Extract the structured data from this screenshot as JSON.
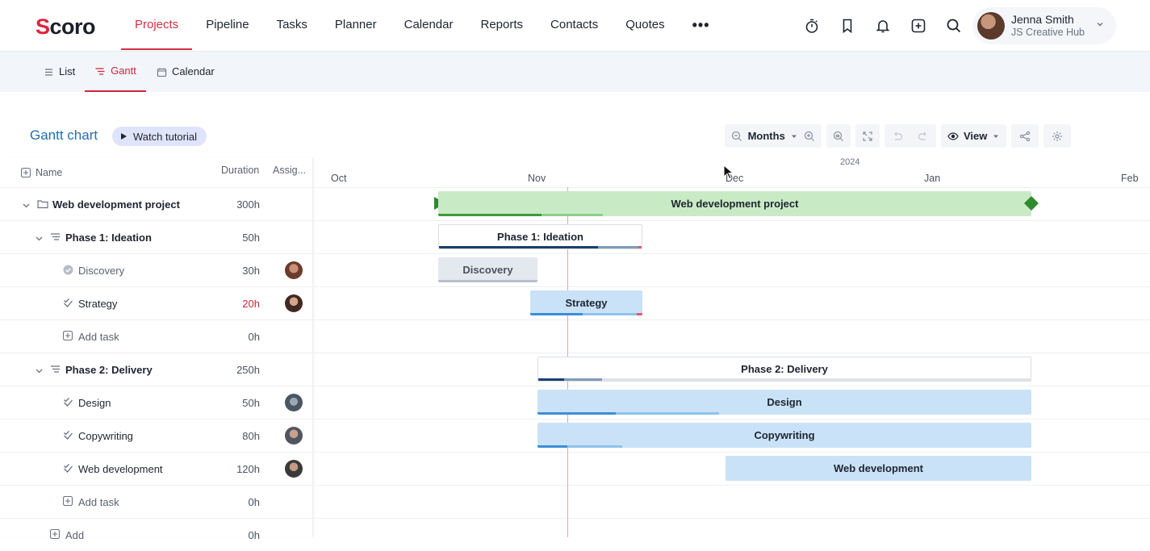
{
  "app": {
    "logo_text": "Scoro"
  },
  "nav": {
    "items": [
      "Projects",
      "Pipeline",
      "Tasks",
      "Planner",
      "Calendar",
      "Reports",
      "Contacts",
      "Quotes"
    ],
    "more": "•••",
    "active": "Projects"
  },
  "top_icons": [
    "stopwatch-icon",
    "bookmark-icon",
    "bell-icon",
    "plus-square-icon",
    "search-icon"
  ],
  "user": {
    "name": "Jenna Smith",
    "company": "JS Creative Hub"
  },
  "subtabs": [
    {
      "label": "List",
      "icon": "list-icon"
    },
    {
      "label": "Gantt",
      "icon": "gantt-icon",
      "active": true
    },
    {
      "label": "Calendar",
      "icon": "calendar-icon"
    }
  ],
  "gantt": {
    "title": "Gantt chart",
    "tutorial": "Watch tutorial"
  },
  "toolbar": {
    "scale": "Months",
    "view": "View"
  },
  "columns": {
    "name": "Name",
    "duration": "Duration",
    "assignee": "Assig..."
  },
  "timeline": {
    "year": "2024",
    "months": [
      "Oct",
      "Nov",
      "Dec",
      "Jan",
      "Feb"
    ]
  },
  "rows": [
    {
      "name": "Web development project",
      "duration": "300h",
      "type": "project"
    },
    {
      "name": "Phase 1: Ideation",
      "duration": "50h",
      "type": "phase"
    },
    {
      "name": "Discovery",
      "duration": "30h",
      "type": "task-done"
    },
    {
      "name": "Strategy",
      "duration": "20h",
      "type": "task",
      "over": true
    },
    {
      "name": "Add task",
      "duration": "0h",
      "type": "add"
    },
    {
      "name": "Phase 2: Delivery",
      "duration": "250h",
      "type": "phase"
    },
    {
      "name": "Design",
      "duration": "50h",
      "type": "task"
    },
    {
      "name": "Copywriting",
      "duration": "80h",
      "type": "task"
    },
    {
      "name": "Web development",
      "duration": "120h",
      "type": "task"
    },
    {
      "name": "Add task",
      "duration": "0h",
      "type": "add"
    },
    {
      "name": "Add",
      "duration": "0h",
      "type": "add"
    }
  ],
  "bars": {
    "project": "Web development project",
    "phase1": "Phase 1: Ideation",
    "discovery": "Discovery",
    "strategy": "Strategy",
    "phase2": "Phase 2: Delivery",
    "design": "Design",
    "copywriting": "Copywriting",
    "webdev": "Web development"
  },
  "colors": {
    "accent": "#d32f45",
    "link": "#1f6fb5",
    "project_bar": "#c8ebc5",
    "task_bar": "#c9e2f7",
    "milestone": "#2e8b2e"
  }
}
